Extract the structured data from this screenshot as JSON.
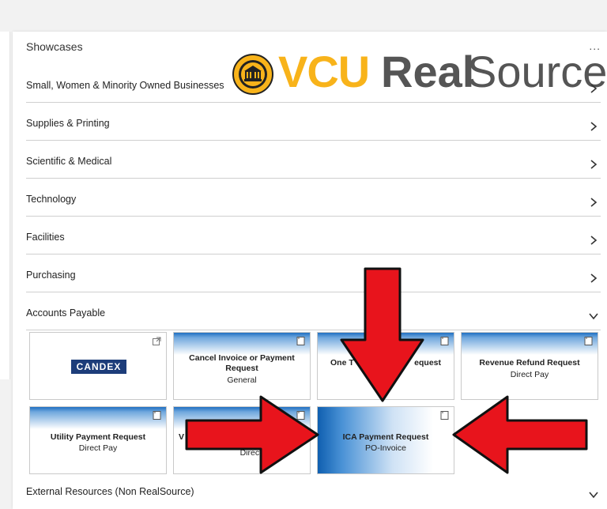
{
  "panel": {
    "title": "Showcases",
    "more_label": "..."
  },
  "logo": {
    "vcu": "VCU",
    "real": "Real",
    "source": "Source"
  },
  "rows": [
    {
      "label": "Small, Women & Minority Owned Businesses",
      "state": "collapsed"
    },
    {
      "label": "Supplies & Printing",
      "state": "collapsed"
    },
    {
      "label": "Scientific & Medical",
      "state": "collapsed"
    },
    {
      "label": "Technology",
      "state": "collapsed"
    },
    {
      "label": "Facilities",
      "state": "collapsed"
    },
    {
      "label": "Purchasing",
      "state": "collapsed"
    },
    {
      "label": "Accounts Payable",
      "state": "expanded"
    },
    {
      "label": "External Resources (Non RealSource)",
      "state": "expanded"
    }
  ],
  "tiles": [
    {
      "title": "",
      "subtitle": "",
      "logo": "CANDEX",
      "icon": "external-link-icon"
    },
    {
      "title": "Cancel Invoice or Payment Request",
      "subtitle": "General",
      "icon": "form-icon"
    },
    {
      "title": "One T",
      "title_end": "equest",
      "subtitle": "",
      "icon": "form-icon"
    },
    {
      "title": "Revenue Refund Request",
      "subtitle": "Direct Pay",
      "icon": "form-icon"
    },
    {
      "title": "Utility Payment Request",
      "subtitle": "Direct Pay",
      "icon": "form-icon"
    },
    {
      "title": "V",
      "subtitle": "Direct Pay",
      "icon": "form-icon"
    },
    {
      "title": "ICA Payment Request",
      "subtitle": "PO-Invoice",
      "icon": "form-icon"
    }
  ],
  "annotation": {
    "arrow_color": "#e8141c",
    "count": 3
  },
  "colors": {
    "vcu_gold": "#f8b31a",
    "tile_blue": "#1f6fc1",
    "candex_navy": "#1d3d7a"
  }
}
